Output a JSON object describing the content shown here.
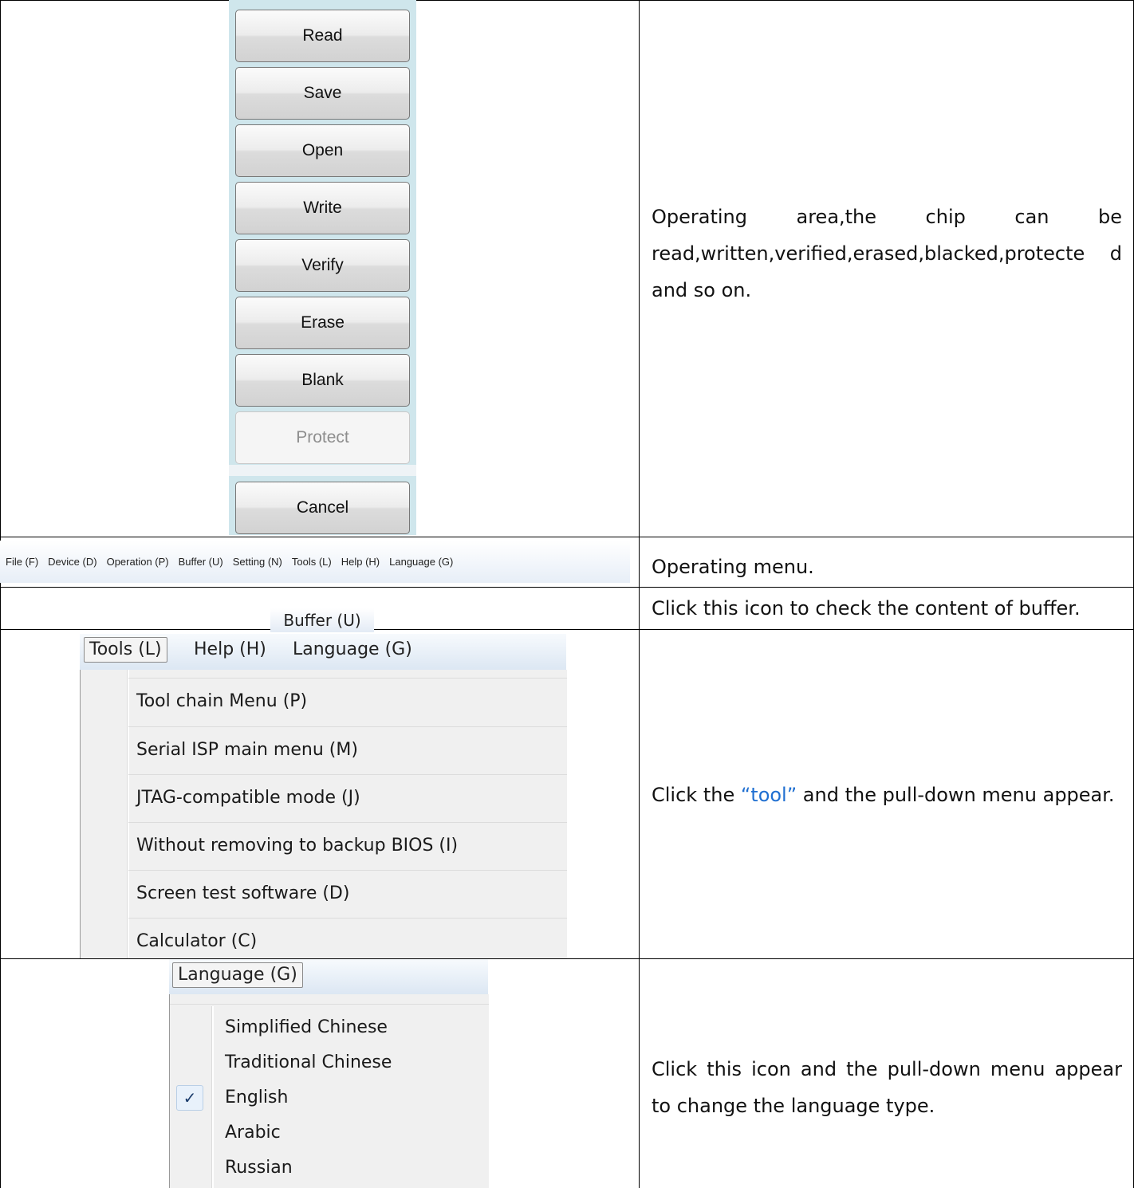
{
  "operation_buttons": [
    {
      "label": "Read",
      "enabled": true
    },
    {
      "label": "Save",
      "enabled": true
    },
    {
      "label": "Open",
      "enabled": true
    },
    {
      "label": "Write",
      "enabled": true
    },
    {
      "label": "Verify",
      "enabled": true
    },
    {
      "label": "Erase",
      "enabled": true
    },
    {
      "label": "Blank",
      "enabled": true
    },
    {
      "label": "Protect",
      "enabled": false
    }
  ],
  "cancel_button": {
    "label": "Cancel"
  },
  "row1_description": "Operating area,the chip can be read,written,verified,erased,blacked,protecte d and so on.",
  "menubar": {
    "items": [
      "File (F)",
      "Device (D)",
      "Operation (P)",
      "Buffer (U)",
      "Setting (N)",
      "Tools (L)",
      "Help (H)",
      "Language (G)"
    ]
  },
  "row2_description": "Operating menu.",
  "buffer_button": {
    "label": "Buffer (U)"
  },
  "row3_description": "Click this icon to check the content of buffer.",
  "tools_menu": {
    "header": [
      "Tools (L)",
      "Help (H)",
      "Language (G)"
    ],
    "items": [
      "Tool chain Menu (P)",
      "Serial ISP main menu (M)",
      "JTAG-compatible mode (J)",
      "Without removing to backup BIOS (I)",
      "Screen test software (D)",
      "Calculator (C)"
    ]
  },
  "row4_description": {
    "before": "Click the ",
    "highlight": "“tool”",
    "after": " and the pull-down menu appear."
  },
  "language_menu": {
    "header": "Language (G)",
    "items": [
      "Simplified Chinese",
      "Traditional Chinese",
      "English",
      "Arabic",
      "Russian"
    ],
    "checked": "English",
    "check_mark": "✓"
  },
  "row5_description": "Click this icon and the pull-down menu appear to change the language type.",
  "colors": {
    "highlight": "#1f6fd1",
    "button_panel_bg": "#cfe6ec"
  }
}
